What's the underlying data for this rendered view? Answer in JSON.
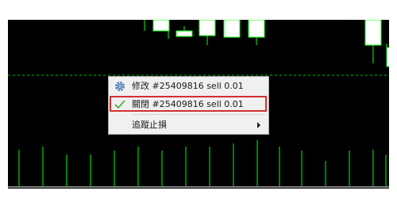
{
  "chart": {
    "background_color": "#000000",
    "candle_color": "#00ff00",
    "bull_fill_color": "#ffffff",
    "grid_line_color": "#00c000"
  },
  "context_menu": {
    "items": [
      {
        "label": "修改 #25409816 sell 0.01",
        "icon": "gear-icon"
      },
      {
        "label": "關閉 #25409816 sell 0.01",
        "icon": "checkmark-icon"
      },
      {
        "label": "追蹤止損",
        "icon": "chevron-right-icon"
      }
    ],
    "highlight_color": "#d32f2f"
  }
}
